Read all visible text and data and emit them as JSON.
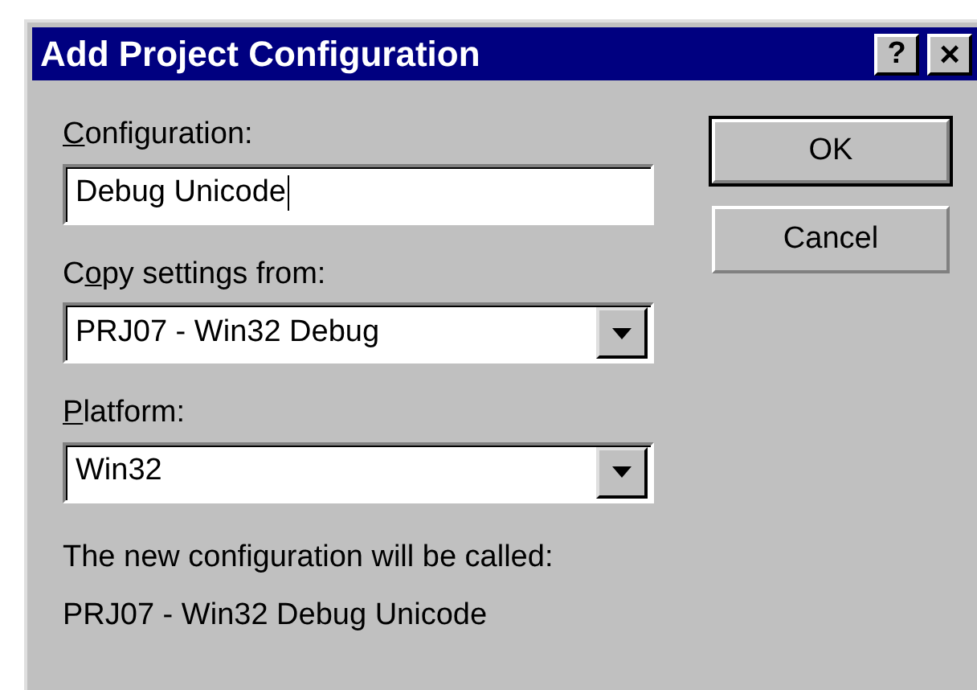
{
  "window": {
    "title": "Add Project Configuration",
    "title_buttons": [
      {
        "kind": "help",
        "label": "?"
      },
      {
        "kind": "close",
        "label": "×"
      }
    ]
  },
  "fields": [
    {
      "kind": "text",
      "label": {
        "key": "C",
        "after": "onfiguration:"
      },
      "value": "Debug Unicode",
      "focused": true
    },
    {
      "kind": "combo",
      "label": {
        "before": "C",
        "key": "o",
        "after": "py settings from:"
      },
      "value": "PRJ07 - Win32 Debug"
    },
    {
      "kind": "combo",
      "label": {
        "key": "P",
        "after": "latform:"
      },
      "value": "Win32"
    }
  ],
  "result": {
    "caption": "The new configuration will be called:",
    "name": "PRJ07 - Win32 Debug Unicode"
  },
  "buttons": [
    {
      "label": "OK",
      "default": true
    },
    {
      "label": "Cancel",
      "default": false
    }
  ]
}
